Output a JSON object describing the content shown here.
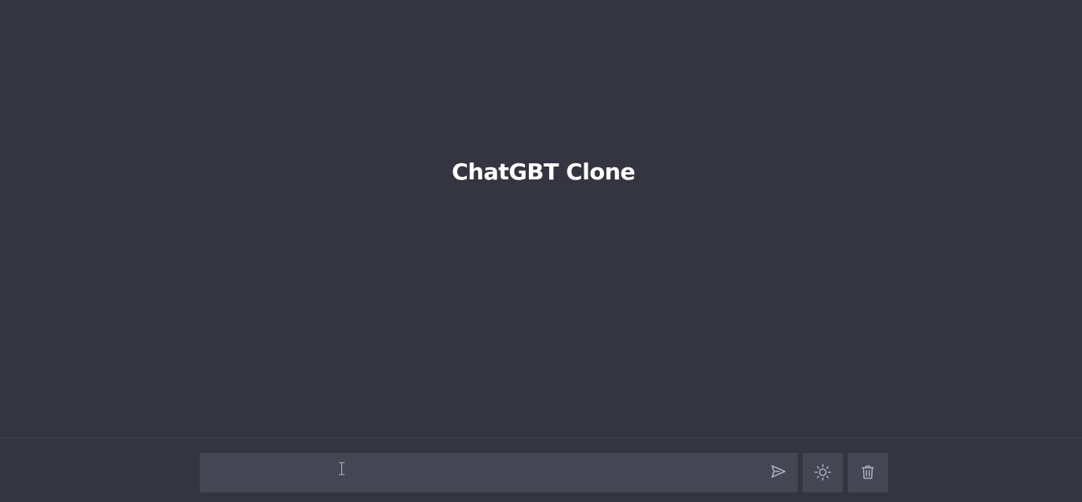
{
  "app": {
    "title": "ChatGBT Clone"
  },
  "input": {
    "value": "",
    "placeholder": ""
  },
  "icons": {
    "send": "send-icon",
    "theme": "sun-icon",
    "delete": "trash-icon",
    "cursor": "text-cursor-icon"
  },
  "colors": {
    "background": "#343541",
    "input_background": "#444654",
    "title": "#ffffff",
    "icon": "#acacbe"
  }
}
